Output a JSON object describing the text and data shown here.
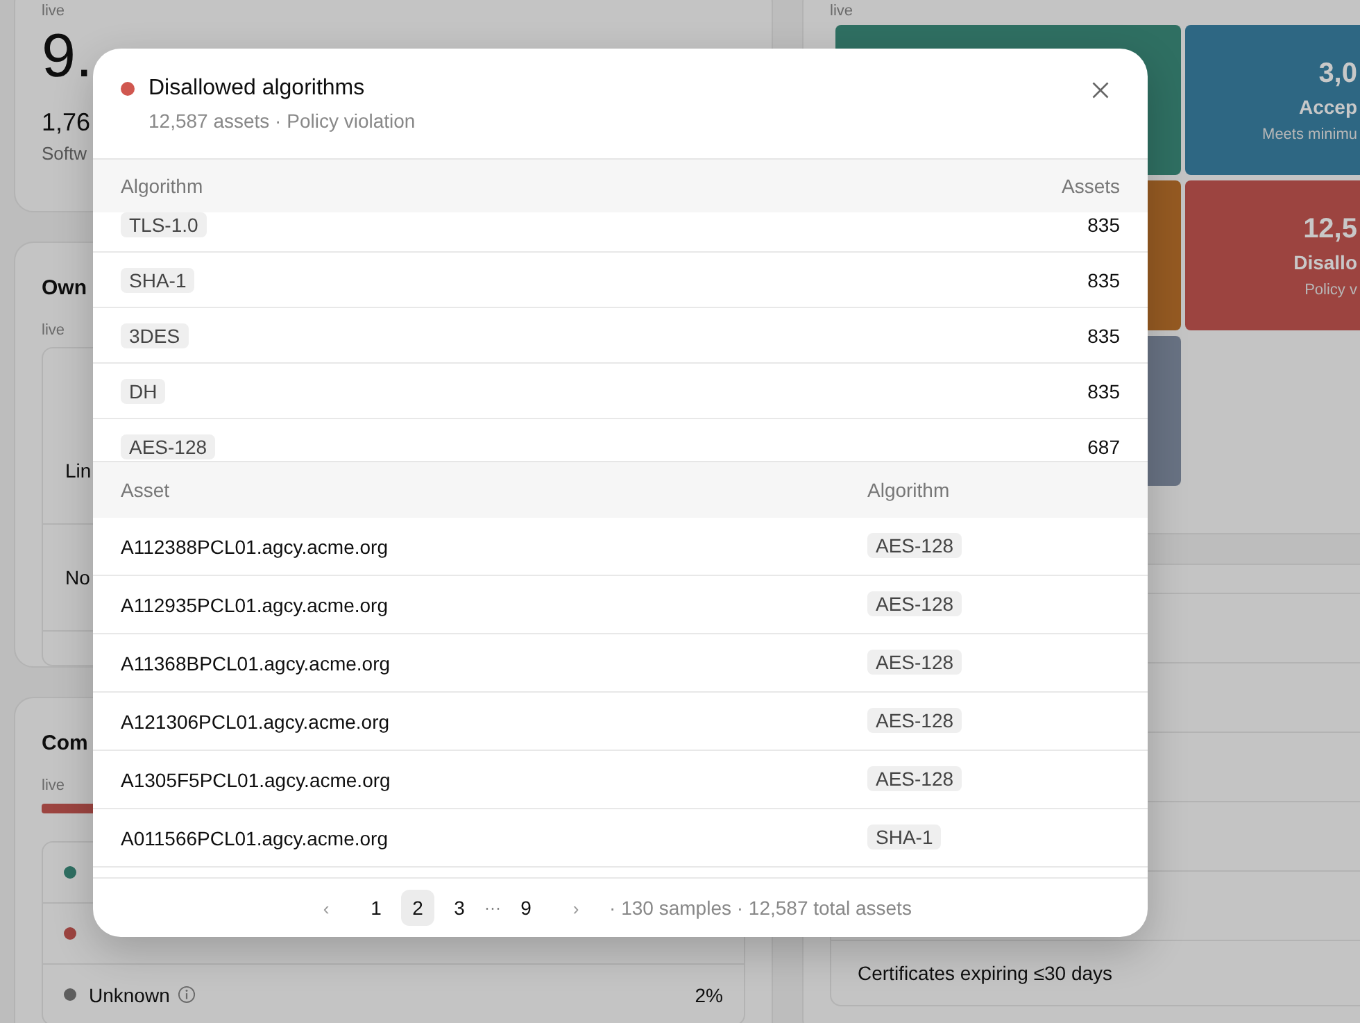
{
  "dashboard": {
    "summary_card": {
      "live": "live",
      "value": "9.",
      "secondary": "1,76",
      "caption": "Softw"
    },
    "owners_card": {
      "title": "Own",
      "live": "live",
      "rows": [
        "Lin",
        "No"
      ]
    },
    "compliance_card": {
      "title": "Com",
      "live": "live",
      "rows": [
        {
          "color": "#2f6f62"
        },
        {
          "color": "#9c4440"
        },
        {
          "color": "#5e5e5e",
          "label": "Unknown",
          "info": true,
          "value": "2%"
        }
      ]
    },
    "posture_card": {
      "live": "live",
      "tiles": [
        {
          "color": "#2f6f62"
        },
        {
          "color": "#2e6783",
          "value": "3,0",
          "label": "Accep",
          "caption": "Meets minimu"
        },
        {
          "color": "#955a22"
        },
        {
          "color": "#9c4440",
          "value": "12,5",
          "label": "Disallo",
          "caption": "Policy v"
        },
        {
          "color": "#687283"
        }
      ]
    },
    "certificates_card": {
      "item": "Certificates expiring ≤30 days"
    }
  },
  "modal": {
    "color": "#d0574f",
    "title": "Disallowed algorithms",
    "subtitle": "12,587 assets · Policy violation",
    "algorithms": {
      "columns": [
        "Algorithm",
        "Assets"
      ],
      "rows": [
        {
          "algorithm": "TLS-1.0",
          "assets": "835"
        },
        {
          "algorithm": "SHA-1",
          "assets": "835"
        },
        {
          "algorithm": "3DES",
          "assets": "835"
        },
        {
          "algorithm": "DH",
          "assets": "835"
        },
        {
          "algorithm": "AES-128",
          "assets": "687"
        }
      ]
    },
    "samples": {
      "columns": [
        "Asset",
        "Algorithm"
      ],
      "rows": [
        {
          "asset": "A112388PCL01.agcy.acme.org",
          "algorithm": "AES-128"
        },
        {
          "asset": "A112935PCL01.agcy.acme.org",
          "algorithm": "AES-128"
        },
        {
          "asset": "A11368BPCL01.agcy.acme.org",
          "algorithm": "AES-128"
        },
        {
          "asset": "A121306PCL01.agcy.acme.org",
          "algorithm": "AES-128"
        },
        {
          "asset": "A1305F5PCL01.agcy.acme.org",
          "algorithm": "AES-128"
        },
        {
          "asset": "A011566PCL01.agcy.acme.org",
          "algorithm": "SHA-1"
        }
      ]
    },
    "pagination": {
      "prev": "‹",
      "next": "›",
      "items": [
        {
          "kind": "page",
          "label": "1",
          "selected": false
        },
        {
          "kind": "page",
          "label": "2",
          "selected": true
        },
        {
          "kind": "page",
          "label": "3",
          "selected": false
        },
        {
          "kind": "gap",
          "label": "···"
        },
        {
          "kind": "page",
          "label": "9",
          "selected": false
        }
      ],
      "summary": "· 130 samples · 12,587 total assets"
    }
  }
}
